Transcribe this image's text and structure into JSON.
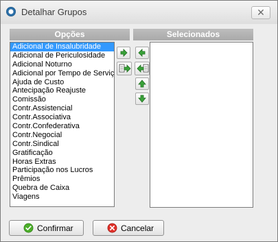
{
  "window": {
    "title": "Detalhar Grupos",
    "close_glyph": "✕"
  },
  "left_panel": {
    "header": "Opções",
    "items": [
      "Adicional de Insalubridade",
      "Adicional de Periculosidade",
      "Adicional Noturno",
      "Adicional por Tempo de Serviço",
      "Ajuda de Custo",
      "Antecipação Reajuste",
      "Comissão",
      "Contr.Assistencial",
      "Contr.Associativa",
      "Contr.Confederativa",
      "Contr.Negocial",
      "Contr.Sindical",
      "Gratificação",
      "Horas Extras",
      "Participação nos Lucros",
      "Prêmios",
      "Quebra de Caixa",
      "Viagens"
    ],
    "selected_index": 0
  },
  "right_panel": {
    "header": "Selecionados",
    "items": []
  },
  "transfer_buttons": [
    {
      "icon": "arrow-right-icon"
    },
    {
      "icon": "move-all-right-icon"
    }
  ],
  "right_buttons": [
    {
      "icon": "arrow-left-icon"
    },
    {
      "icon": "move-all-left-icon"
    },
    {
      "icon": "arrow-up-icon"
    },
    {
      "icon": "arrow-down-icon"
    }
  ],
  "footer": {
    "confirm_label": "Confirmar",
    "cancel_label": "Cancelar"
  },
  "colors": {
    "selection": "#3399ff",
    "header_bg": "#b3b3b3",
    "green_arrow": "#3aa33a",
    "confirm_icon": "#4caf2a",
    "cancel_icon": "#e2312a"
  }
}
